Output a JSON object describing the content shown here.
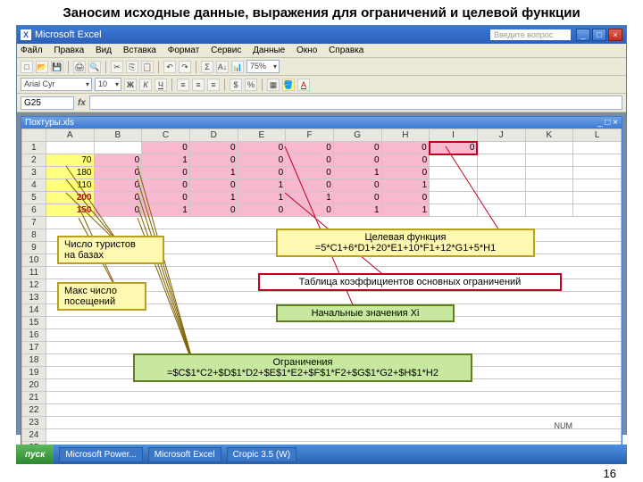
{
  "slide": {
    "title": "Заносим исходные данные, выражения для ограничений и целевой функции",
    "page_number": "16"
  },
  "window": {
    "app_title": "Microsoft Excel",
    "help_placeholder": "Введите вопрос",
    "sheet_title": "Похтуры.xls",
    "menus": [
      "Файл",
      "Правка",
      "Вид",
      "Вставка",
      "Формат",
      "Сервис",
      "Данные",
      "Окно",
      "Справка"
    ],
    "namebox": "G25",
    "zoom": "75%",
    "font": "Arial Cyr",
    "font_size": "10"
  },
  "columns": [
    "A",
    "B",
    "C",
    "D",
    "E",
    "F",
    "G",
    "H",
    "I",
    "J",
    "K",
    "L"
  ],
  "grid": {
    "r1": {
      "C": "0",
      "D": "0",
      "E": "0",
      "F": "0",
      "G": "0",
      "H": "0",
      "I": "0"
    },
    "r2": {
      "A": "70",
      "B": "0",
      "C": "1",
      "D": "0",
      "E": "0",
      "F": "0",
      "G": "0",
      "H": "0"
    },
    "r3": {
      "A": "180",
      "B": "0",
      "C": "0",
      "D": "1",
      "E": "0",
      "F": "0",
      "G": "1",
      "H": "0"
    },
    "r4": {
      "A": "110",
      "B": "0",
      "C": "0",
      "D": "0",
      "E": "1",
      "F": "0",
      "G": "0",
      "H": "1"
    },
    "r5": {
      "A": "200",
      "B": "0",
      "C": "0",
      "D": "1",
      "E": "1",
      "F": "1",
      "G": "0",
      "H": "0"
    },
    "r6": {
      "A": "150",
      "B": "0",
      "C": "1",
      "D": "0",
      "E": "0",
      "F": "0",
      "G": "1",
      "H": "1"
    }
  },
  "callouts": {
    "tourists_title": "Число туристов",
    "tourists_sub": "на базах",
    "max_visits": "Макс число посещений",
    "objective_title": "Целевая функция",
    "objective_formula": "=5*C1+6*D1+20*E1+10*F1+12*G1+5*H1",
    "coeff_table": "Таблица коэффициентов основных ограничений",
    "initial_x": "Начальные значения Xi",
    "constraints_title": "Ограничения",
    "constraints_formula": "=$C$1*C2+$D$1*D2+$E$1*E2+$F$1*F2+$G$1*G2+$H$1*H2"
  },
  "taskbar": {
    "start": "пуск",
    "items": [
      "Microsoft Power...",
      "Microsoft Excel",
      "Cropic 3.5 (W)"
    ]
  },
  "status": {
    "mode": "NUM"
  }
}
